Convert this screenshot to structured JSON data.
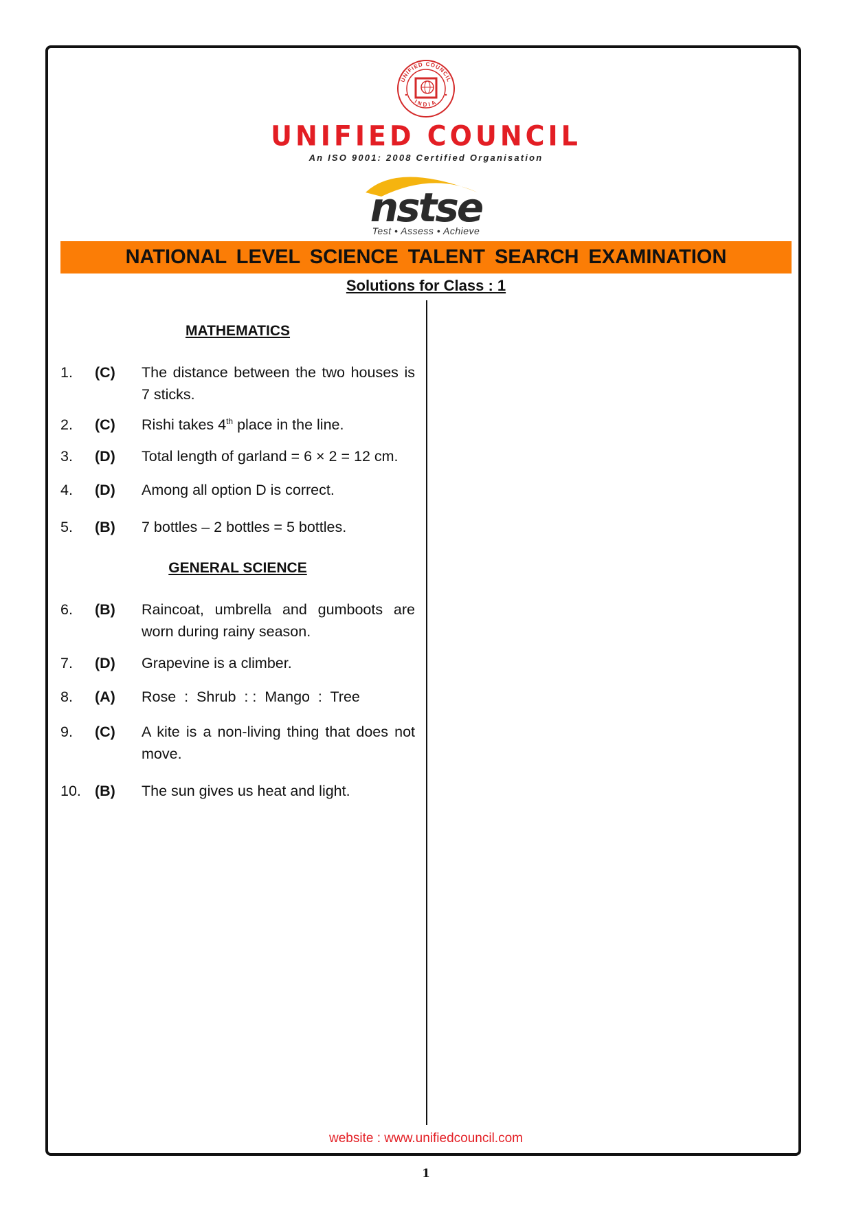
{
  "header": {
    "seal_top_text": "UNIFIED COUNCIL",
    "seal_bottom_text": "INDIA",
    "organization": "UNIFIED COUNCIL",
    "certification": "An ISO 9001: 2008 Certified  Organisation",
    "exam_logo": "nstse",
    "exam_tagline": "Test • Assess • Achieve",
    "banner_title": "NATIONAL LEVEL SCIENCE TALENT SEARCH EXAMINATION",
    "subtitle": "Solutions for Class : 1",
    "colors": {
      "brand_red": "#e31e24",
      "banner_orange": "#fb7d06",
      "logo_yellow": "#f5b40f",
      "logo_dark": "#2b2b2b"
    }
  },
  "sections": [
    {
      "title": "MATHEMATICS",
      "items": [
        {
          "num": "1.",
          "option": "(C)",
          "text": "The distance between the two houses is 7 sticks."
        },
        {
          "num": "2.",
          "option": "(C)",
          "text_before": "Rishi takes 4",
          "text_sup": "th",
          "text_after": " place in the line."
        },
        {
          "num": "3.",
          "option": "(D)",
          "text": "Total length of garland = 6 × 2 = 12 cm."
        },
        {
          "num": "4.",
          "option": "(D)",
          "text": "Among all option D is correct."
        },
        {
          "num": "5.",
          "option": "(B)",
          "text": "7 bottles – 2 bottles = 5 bottles."
        }
      ]
    },
    {
      "title": "GENERAL SCIENCE",
      "items": [
        {
          "num": "6.",
          "option": "(B)",
          "text": "Raincoat, umbrella and gumboots are worn during rainy season."
        },
        {
          "num": "7.",
          "option": "(D)",
          "text": "Grapevine is a climber."
        },
        {
          "num": "8.",
          "option": "(A)",
          "text": "Rose  :  Shrub  : :  Mango  :  Tree"
        },
        {
          "num": "9.",
          "option": "(C)",
          "text": "A kite is a non-living thing that does not move."
        },
        {
          "num": "10.",
          "option": "(B)",
          "text": "The sun gives us heat and light."
        }
      ]
    }
  ],
  "footer": {
    "website": "website : www.unifiedcouncil.com",
    "page_number": "1"
  }
}
